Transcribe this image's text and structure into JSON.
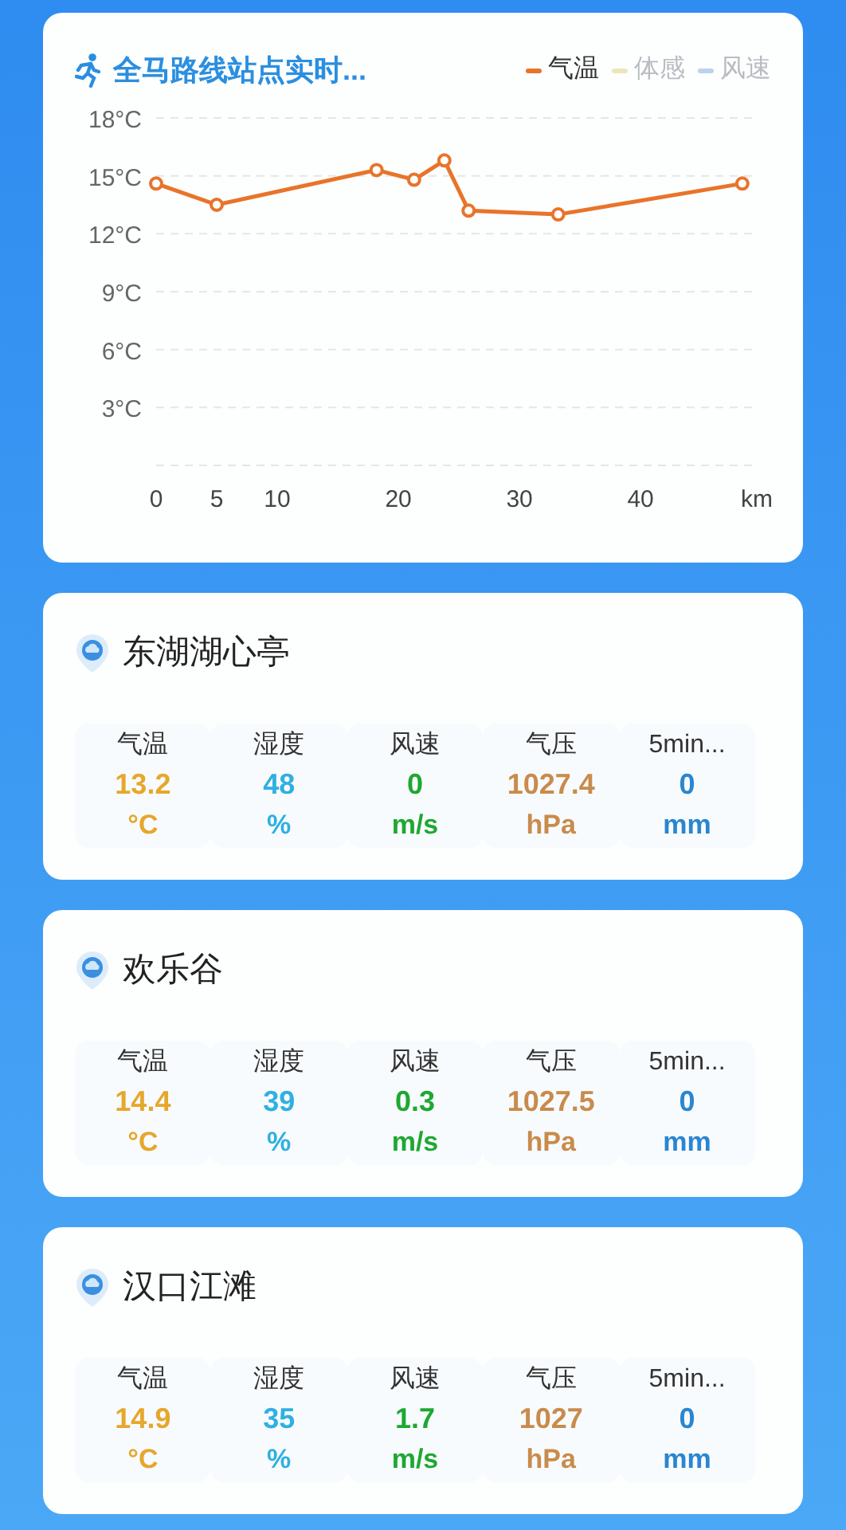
{
  "route_chart": {
    "title": "全马路线站点实时...",
    "other_legend": [
      {
        "label": "体感",
        "color": "#ece6b8",
        "selected": false
      },
      {
        "label": "风速",
        "color": "#b9d3ec",
        "selected": false
      }
    ],
    "chart_data": {
      "type": "line",
      "xlabel": "km",
      "x": [
        0,
        5,
        18.2,
        21.3,
        23.8,
        25.8,
        33.2,
        48.4
      ],
      "series": [
        {
          "name": "气温",
          "color": "#e8742a",
          "marker": "o",
          "values": [
            14.6,
            13.5,
            15.3,
            14.8,
            15.8,
            13.2,
            13.0,
            14.6
          ]
        }
      ],
      "xlim": [
        0,
        49.2
      ],
      "ylim": [
        0,
        18
      ],
      "grid": true,
      "xticks": [
        0,
        5,
        10,
        20,
        30,
        40
      ],
      "yticks": [
        {
          "value": 3,
          "label": "3°C"
        },
        {
          "value": 6,
          "label": "6°C"
        },
        {
          "value": 9,
          "label": "9°C"
        },
        {
          "value": 12,
          "label": "12°C"
        },
        {
          "value": 15,
          "label": "15°C"
        },
        {
          "value": 18,
          "label": "18°C"
        }
      ]
    }
  },
  "stations": [
    {
      "name": "东湖湖心亭",
      "metrics": [
        {
          "label": "气温",
          "value": "13.2",
          "unit": "°C",
          "color": "#e6a72c"
        },
        {
          "label": "湿度",
          "value": "48",
          "unit": "%",
          "color": "#2fb0e0"
        },
        {
          "label": "风速",
          "value": "0",
          "unit": "m/s",
          "color": "#1ea832"
        },
        {
          "label": "气压",
          "value": "1027.4",
          "unit": "hPa",
          "color": "#c98b4c"
        },
        {
          "label": "5min...",
          "value": "0",
          "unit": "mm",
          "color": "#2a86d0"
        }
      ]
    },
    {
      "name": "欢乐谷",
      "metrics": [
        {
          "label": "气温",
          "value": "14.4",
          "unit": "°C",
          "color": "#e6a72c"
        },
        {
          "label": "湿度",
          "value": "39",
          "unit": "%",
          "color": "#2fb0e0"
        },
        {
          "label": "风速",
          "value": "0.3",
          "unit": "m/s",
          "color": "#1ea832"
        },
        {
          "label": "气压",
          "value": "1027.5",
          "unit": "hPa",
          "color": "#c98b4c"
        },
        {
          "label": "5min...",
          "value": "0",
          "unit": "mm",
          "color": "#2a86d0"
        }
      ]
    },
    {
      "name": "汉口江滩",
      "metrics": [
        {
          "label": "气温",
          "value": "14.9",
          "unit": "°C",
          "color": "#e6a72c"
        },
        {
          "label": "湿度",
          "value": "35",
          "unit": "%",
          "color": "#2fb0e0"
        },
        {
          "label": "风速",
          "value": "1.7",
          "unit": "m/s",
          "color": "#1ea832"
        },
        {
          "label": "气压",
          "value": "1027",
          "unit": "hPa",
          "color": "#c98b4c"
        },
        {
          "label": "5min...",
          "value": "0",
          "unit": "mm",
          "color": "#2a86d0"
        }
      ]
    }
  ]
}
